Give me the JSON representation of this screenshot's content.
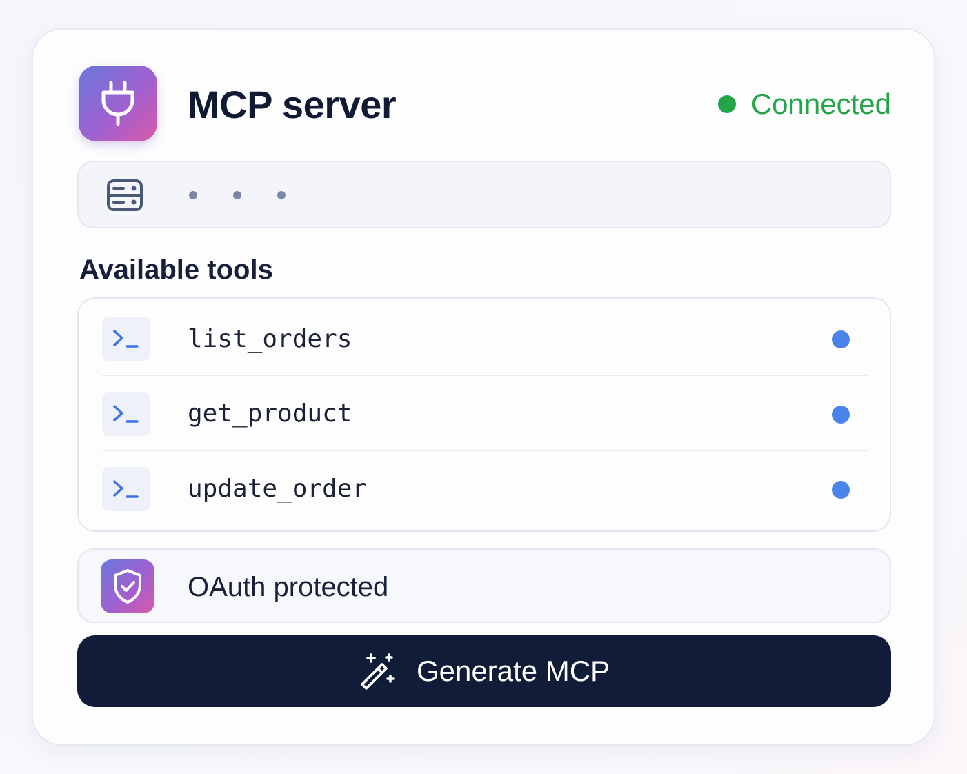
{
  "header": {
    "icon": "plug-icon",
    "title": "MCP server",
    "status": {
      "label": "Connected",
      "color": "#22a447"
    }
  },
  "server_url": {
    "icon": "server-icon",
    "value_masked": "• • •"
  },
  "tools": {
    "heading": "Available tools",
    "items": [
      {
        "name": "list_orders",
        "icon": "terminal-icon",
        "status_color": "#4a84ea"
      },
      {
        "name": "get_product",
        "icon": "terminal-icon",
        "status_color": "#4a84ea"
      },
      {
        "name": "update_order",
        "icon": "terminal-icon",
        "status_color": "#4a84ea"
      }
    ]
  },
  "auth": {
    "icon": "shield-check-icon",
    "label": "OAuth protected"
  },
  "action": {
    "icon": "magic-wand-icon",
    "label": "Generate MCP",
    "color": "#111c38"
  },
  "accent_gradient": [
    "#6a78dc",
    "#a060d0",
    "#d95aa8"
  ]
}
